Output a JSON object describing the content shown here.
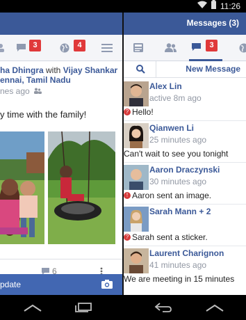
{
  "status_bar": {
    "time": "11:26"
  },
  "left": {
    "tabs": {
      "messages_count": "3",
      "notifications_count": "4"
    },
    "post": {
      "author_partial": "ha Dhingra",
      "with_word": "with",
      "tagged": "Vijay Shankar",
      "location_partial": "ennai, Tamil Nadu",
      "time_partial": "nes ago",
      "text_partial": "y time with the family!",
      "comments_count": "6"
    },
    "composer_partial": "pdate"
  },
  "right": {
    "header_title": "Messages (3)",
    "tabs": {
      "messages_count": "3"
    },
    "new_message_label": "New Message",
    "conversations": [
      {
        "name": "Alex Lin",
        "time": "active 8m ago",
        "text": "Hello!",
        "status": "unread"
      },
      {
        "name": "Qianwen Li",
        "time": "25 minutes ago",
        "text": "Can't wait to see you tonight",
        "status": "none"
      },
      {
        "name": "Aaron Draczynski",
        "time": "30 minutes ago",
        "text": "Aaron sent an image.",
        "status": "unread"
      },
      {
        "name": "Sarah Mann + 2",
        "time": "",
        "text": "Sarah sent a sticker.",
        "status": "unread"
      },
      {
        "name": "Laurent Charignon",
        "time": "41 minutes ago",
        "text": "We are meeting in 15 minutes",
        "status": "none"
      }
    ]
  },
  "colors": {
    "brand": "#3b5998",
    "badge": "#e0393a"
  }
}
